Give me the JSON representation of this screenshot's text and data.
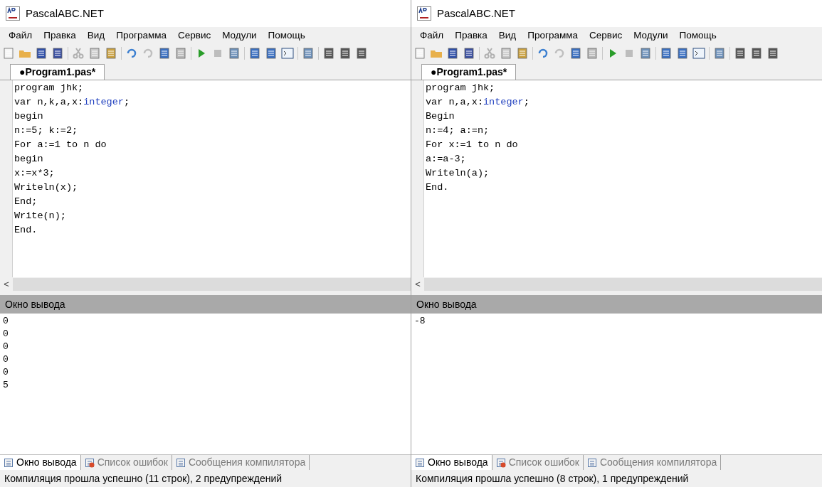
{
  "windows": [
    {
      "title": "PascalABC.NET",
      "menu": [
        "Файл",
        "Правка",
        "Вид",
        "Программа",
        "Сервис",
        "Модули",
        "Помощь"
      ],
      "file_tab": {
        "label": "●Program1.pas*",
        "selected": true
      },
      "code": [
        [
          {
            "kind": "plain",
            "text": "program jhk;"
          }
        ],
        [
          {
            "kind": "plain",
            "text": "var n,k,a,x:"
          },
          {
            "kind": "type",
            "text": "integer"
          },
          {
            "kind": "plain",
            "text": ";"
          }
        ],
        [
          {
            "kind": "plain",
            "text": "begin"
          }
        ],
        [
          {
            "kind": "plain",
            "text": "n:=5; k:=2;"
          }
        ],
        [
          {
            "kind": "plain",
            "text": "For a:=1 to n do"
          }
        ],
        [
          {
            "kind": "plain",
            "text": "begin"
          }
        ],
        [
          {
            "kind": "plain",
            "text": "x:=x*3;"
          }
        ],
        [
          {
            "kind": "plain",
            "text": "Writeln(x);"
          }
        ],
        [
          {
            "kind": "plain",
            "text": "End;"
          }
        ],
        [
          {
            "kind": "plain",
            "text": "Write(n);"
          }
        ],
        [
          {
            "kind": "plain",
            "text": "End."
          }
        ]
      ],
      "scroll_arrow": "<",
      "output_title": "Окно вывода",
      "output": [
        "0",
        "0",
        "0",
        "0",
        "0",
        "5"
      ],
      "bottom_tabs": [
        {
          "label": "Окно вывода",
          "selected": true
        },
        {
          "label": "Список ошибок",
          "selected": false
        },
        {
          "label": "Сообщения компилятора",
          "selected": false
        }
      ],
      "status": "Компиляция прошла успешно (11 строк), 2 предупреждений"
    },
    {
      "title": "PascalABC.NET",
      "menu": [
        "Файл",
        "Правка",
        "Вид",
        "Программа",
        "Сервис",
        "Модули",
        "Помощь"
      ],
      "file_tab": {
        "label": "●Program1.pas*",
        "selected": true
      },
      "code": [
        [
          {
            "kind": "plain",
            "text": "program jhk;"
          }
        ],
        [
          {
            "kind": "plain",
            "text": "var n,a,x:"
          },
          {
            "kind": "type",
            "text": "integer"
          },
          {
            "kind": "plain",
            "text": ";"
          }
        ],
        [
          {
            "kind": "plain",
            "text": "Begin"
          }
        ],
        [
          {
            "kind": "plain",
            "text": "n:=4; a:=n;"
          }
        ],
        [
          {
            "kind": "plain",
            "text": "For x:=1 to n do"
          }
        ],
        [
          {
            "kind": "plain",
            "text": "a:=a-3;"
          }
        ],
        [
          {
            "kind": "plain",
            "text": "Writeln(a);"
          }
        ],
        [
          {
            "kind": "plain",
            "text": "End."
          }
        ]
      ],
      "scroll_arrow": "<",
      "output_title": "Окно вывода",
      "output": [
        "-8"
      ],
      "bottom_tabs": [
        {
          "label": "Окно вывода",
          "selected": true
        },
        {
          "label": "Список ошибок",
          "selected": false
        },
        {
          "label": "Сообщения компилятора",
          "selected": false
        }
      ],
      "status": "Компиляция прошла успешно (8 строк), 1 предупреждений"
    }
  ]
}
